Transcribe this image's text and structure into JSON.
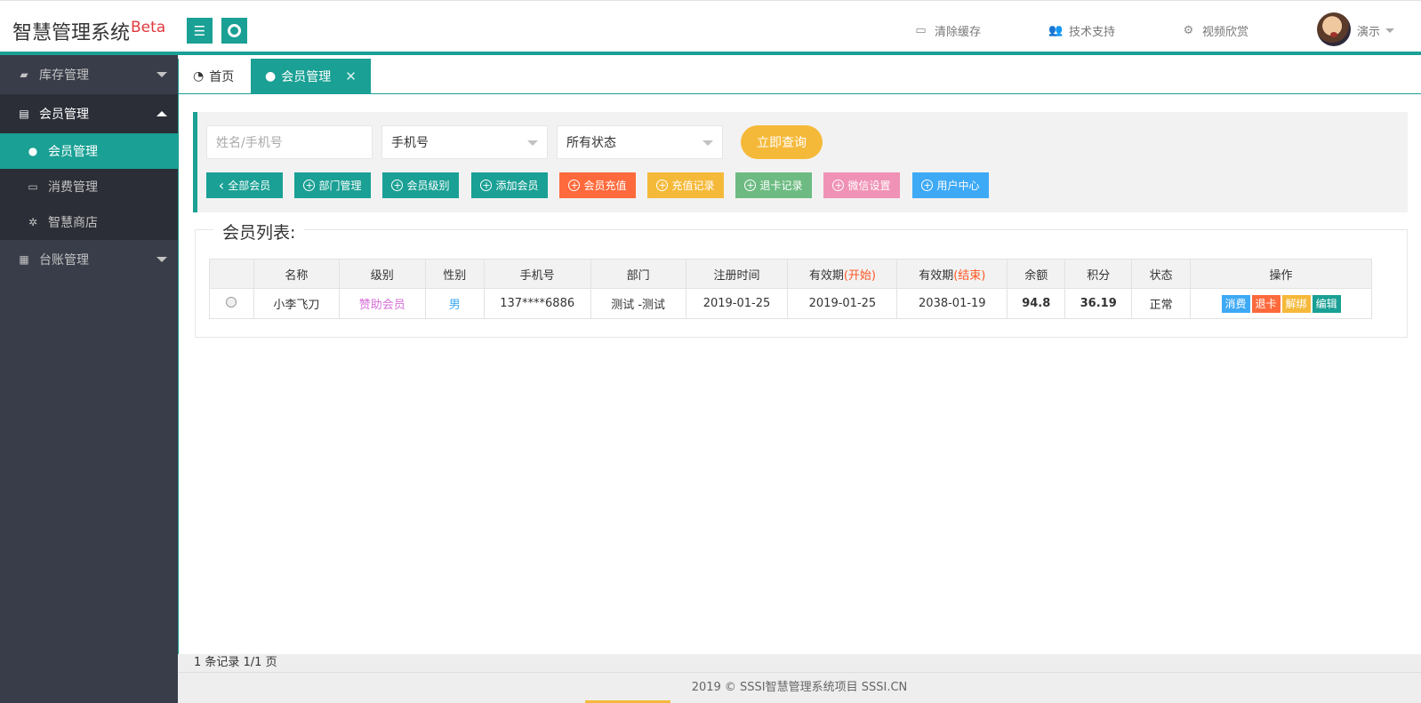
{
  "header": {
    "title": "智慧管理系统",
    "title_sup": "Beta",
    "nav": [
      {
        "label": "清除缓存",
        "icon": "monitor-icon"
      },
      {
        "label": "技术支持",
        "icon": "users-icon"
      },
      {
        "label": "视频欣赏",
        "icon": "gears-icon"
      }
    ],
    "user": {
      "name": "演示"
    }
  },
  "sidebar": {
    "groups": [
      {
        "label": "库存管理",
        "icon": "folder-icon",
        "open": false
      },
      {
        "label": "会员管理",
        "icon": "table-icon",
        "open": true,
        "items": [
          {
            "label": "会员管理",
            "icon": "user-icon",
            "active": true
          },
          {
            "label": "消费管理",
            "icon": "monitor-icon",
            "active": false
          },
          {
            "label": "智慧商店",
            "icon": "palm-icon",
            "active": false
          }
        ]
      },
      {
        "label": "台账管理",
        "icon": "grid-icon",
        "open": false
      }
    ]
  },
  "tabs": [
    {
      "label": "首页",
      "icon": "dashboard-icon",
      "active": false
    },
    {
      "label": "会员管理",
      "icon": "user-icon",
      "active": true,
      "close": "✕"
    }
  ],
  "search": {
    "name_placeholder": "姓名/手机号",
    "type_select": "手机号",
    "status_select": "所有状态",
    "query_button": "立即查询"
  },
  "actions": [
    {
      "label": "全部会员",
      "color": "#1aa094",
      "prefix": "‹"
    },
    {
      "label": "部门管理",
      "color": "#1aa094",
      "prefix": "+"
    },
    {
      "label": "会员级别",
      "color": "#1aa094",
      "prefix": "+"
    },
    {
      "label": "添加会员",
      "color": "#1aa094",
      "prefix": "+"
    },
    {
      "label": "会员充值",
      "color": "#ff6a3c",
      "prefix": "+"
    },
    {
      "label": "充值记录",
      "color": "#f5b93a",
      "prefix": "+"
    },
    {
      "label": "退卡记录",
      "color": "#6dbb82",
      "prefix": "+"
    },
    {
      "label": "微信设置",
      "color": "#ef92b5",
      "prefix": "+"
    },
    {
      "label": "用户中心",
      "color": "#3ea9f5",
      "prefix": "+"
    }
  ],
  "list": {
    "legend": "会员列表:",
    "columns": [
      "",
      "名称",
      "级别",
      "性别",
      "手机号",
      "部门",
      "注册时间",
      "有效期",
      "有效期",
      "余额",
      "积分",
      "状态",
      "操作"
    ],
    "col_suffix": {
      "start": "(开始)",
      "end": "(结束)"
    },
    "rows": [
      {
        "name": "小李飞刀",
        "level": "赞助会员",
        "gender": "男",
        "phone": "137****6886",
        "dept": "测试 -测试",
        "reg_time": "2019-01-25",
        "valid_start": "2019-01-25",
        "valid_end": "2038-01-19",
        "balance": "94.8",
        "points": "36.19",
        "status": "正常",
        "ops": [
          {
            "label": "消费",
            "color": "#3ea9f5"
          },
          {
            "label": "退卡",
            "color": "#ff6a3c"
          },
          {
            "label": "解绑",
            "color": "#f5b93a"
          },
          {
            "label": "编辑",
            "color": "#1aa094"
          }
        ]
      }
    ]
  },
  "pager": {
    "text": "1 条记录 1/1 页"
  },
  "footer": {
    "text": "2019 ©  SSSI智慧管理系统项目  SSSI.CN"
  }
}
